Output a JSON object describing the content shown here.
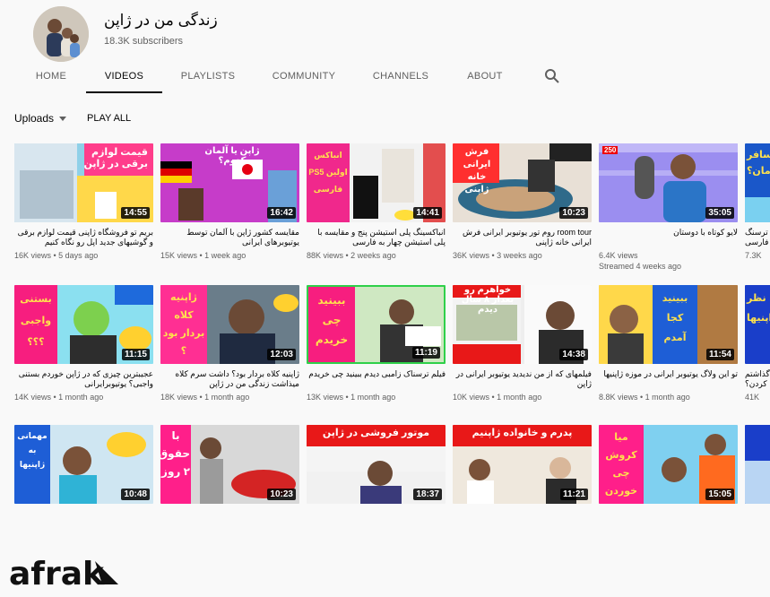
{
  "channel": {
    "name": "زندگی من در ژاپن",
    "subscribers": "18.3K subscribers"
  },
  "tabs": [
    {
      "label": "HOME",
      "active": false
    },
    {
      "label": "VIDEOS",
      "active": true
    },
    {
      "label": "PLAYLISTS",
      "active": false
    },
    {
      "label": "COMMUNITY",
      "active": false
    },
    {
      "label": "CHANNELS",
      "active": false
    },
    {
      "label": "ABOUT",
      "active": false
    }
  ],
  "toolbar": {
    "sort_label": "Uploads",
    "play_all": "PLAY ALL"
  },
  "videos": [
    {
      "thumb_text": "قیمت لوازم برقی در ژاپن",
      "duration": "14:55",
      "title": "بریم تو فروشگاه ژاپنی قیمت لوازم برقی و گوشیهای جدید اپل رو نگاه کنیم",
      "meta": "16K views • 5 days ago"
    },
    {
      "thumb_text": "ژاپن یا آلمان کدوم؟",
      "duration": "16:42",
      "title": "مقایسه کشور ژاپن با آلمان توسط یوتیوبرهای ایرانی",
      "meta": "15K views • 1 week ago"
    },
    {
      "thumb_text": "انباکس اولین PS5 فارسی",
      "duration": "14:41",
      "title": "انباکسینگ پلی استیشن پنج و مقایسه با پلی استیشن چهار به فارسی",
      "meta": "88K views • 2 weeks ago"
    },
    {
      "thumb_text": "فرش ایرانی خانه ژاپنی",
      "duration": "10:23",
      "title": "room tour روم تور یوتیوبر ایرانی فرش ایرانی خانه ژاپنی",
      "meta": "36K views • 3 weeks ago"
    },
    {
      "thumb_text": "250",
      "duration": "35:05",
      "title": "لایو کوتاه با دوستان",
      "meta": "6.4K views",
      "meta2": "Streamed 4 weeks ago"
    },
    {
      "thumb_text": "سافر مان؟",
      "duration": "",
      "title": "ترسنگ فارسی",
      "meta": "7.3K"
    },
    {
      "thumb_text": "بستنی واجبی ؟؟؟",
      "duration": "11:15",
      "title": "عجیبترین چیزی که در ژاپن خوردم بستنی واجبی؟ یوتیوبرایرانی",
      "meta": "14K views • 1 month ago"
    },
    {
      "thumb_text": "ژاپنیه کلاه بردار بود ؟",
      "duration": "12:03",
      "title": "ژاپنیه کلاه بردار بود؟ داشت سرم کلاه میذاشت زندگی من در ژاپن",
      "meta": "18K views • 1 month ago"
    },
    {
      "thumb_text": "ببینید چی خریدم",
      "duration": "11:19",
      "title": "فیلم ترسناک زامبی دیدم ببینید چی خریدم",
      "meta": "13K views • 1 month ago"
    },
    {
      "thumb_text": "خواهرم رو بعداز ۸ سال دیدم",
      "duration": "14:38",
      "title": "فیلمهای که از من ندیدید یوتیوبر ایرانی در ژاپن",
      "meta": "10K views • 1 month ago"
    },
    {
      "thumb_text": "ببینید کجا آمدم",
      "duration": "11:54",
      "title": "تو این ولاگ یوتیوبر ایرانی در موزه ژاپنیها",
      "meta": "8.8K views • 1 month ago"
    },
    {
      "thumb_text": "نظر ژاپنیها",
      "duration": "",
      "title": "گذاشتم کردن؟",
      "meta": "41K"
    },
    {
      "thumb_text": "مهمانی به ژاپنیها",
      "duration": "10:48",
      "title": "",
      "meta": ""
    },
    {
      "thumb_text": "با حقوق ۲ روز",
      "duration": "10:23",
      "title": "",
      "meta": ""
    },
    {
      "thumb_text": "موتور فروشی در ژاپن",
      "duration": "18:37",
      "title": "",
      "meta": ""
    },
    {
      "thumb_text": "پدرم و خانواده ژاپنیم",
      "duration": "11:21",
      "title": "",
      "meta": ""
    },
    {
      "thumb_text": "میا کروش چی خوردن",
      "duration": "15:05",
      "title": "",
      "meta": ""
    },
    {
      "thumb_text": "",
      "duration": "",
      "title": "",
      "meta": ""
    }
  ],
  "watermark": {
    "text": "afrak"
  }
}
